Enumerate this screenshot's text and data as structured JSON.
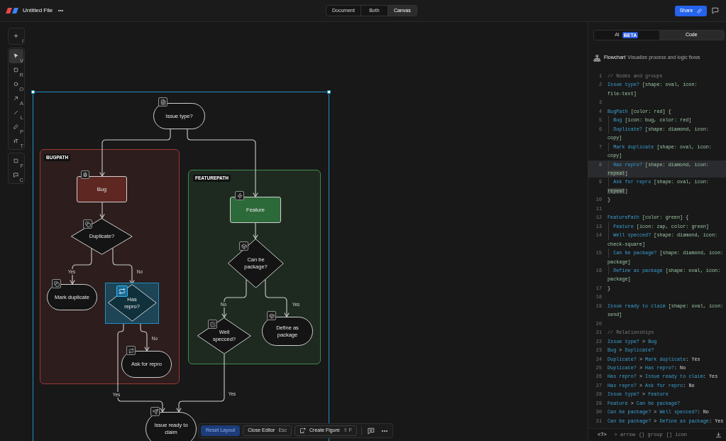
{
  "top_bar": {
    "title": "Untitled File",
    "view_modes": [
      {
        "label": "Document",
        "selected": false
      },
      {
        "label": "Both",
        "selected": false
      },
      {
        "label": "Canvas",
        "selected": true
      }
    ],
    "share_button": "Share"
  },
  "toolbar": {
    "groups": [
      {
        "tools": [
          {
            "shortcut": "I",
            "selected": false
          }
        ]
      },
      {
        "tools": [
          {
            "shortcut": "V",
            "selected": true
          },
          {
            "shortcut": "R",
            "selected": false
          },
          {
            "shortcut": "O",
            "selected": false
          },
          {
            "shortcut": "A",
            "selected": false
          },
          {
            "shortcut": "L",
            "selected": false
          },
          {
            "shortcut": "P",
            "selected": false
          },
          {
            "shortcut": "T",
            "selected": false
          }
        ]
      },
      {
        "tools": [
          {
            "shortcut": "F",
            "selected": false
          },
          {
            "shortcut": "C",
            "selected": false
          }
        ]
      }
    ]
  },
  "canvas": {
    "groups": [
      {
        "label": "BUGPATH",
        "color": "#9b3a35"
      },
      {
        "label": "FEATUREPATH",
        "color": "#3f8a4d"
      }
    ],
    "nodes": [
      {
        "label": "Issue type?",
        "kind": "oval",
        "selected": false
      },
      {
        "label": "Bug",
        "kind": "rect",
        "color": "#5e2722",
        "selected": false
      },
      {
        "label": "Duplicate?",
        "kind": "diamond",
        "selected": false
      },
      {
        "label": "Mark duplicate",
        "kind": "oval",
        "selected": false
      },
      {
        "label": "Has repro?",
        "kind": "diamond",
        "selected": true
      },
      {
        "label": "Ask for repro",
        "kind": "oval",
        "selected": false
      },
      {
        "label": "Feature",
        "kind": "rect",
        "color": "#2d6a3a",
        "selected": false
      },
      {
        "label": "Can be package?",
        "kind": "diamond",
        "selected": false
      },
      {
        "label": "Well specced?",
        "kind": "diamond",
        "selected": false
      },
      {
        "label": "Define as package",
        "kind": "oval",
        "selected": false
      },
      {
        "label": "Issue ready to claim",
        "kind": "oval",
        "selected": false
      }
    ],
    "edge_labels": [
      "Yes",
      "No",
      "No",
      "Yes",
      "No",
      "Yes",
      "Yes"
    ]
  },
  "canvas_toolbar": {
    "buttons": [
      {
        "label": "Reset Layout",
        "kind": "primary"
      },
      {
        "label": "Close Editor",
        "shortcut": "Esc",
        "kind": "secondary"
      },
      {
        "label": "Create Figure",
        "shortcut": "⇧ F",
        "kind": "secondary"
      }
    ]
  },
  "side_panel": {
    "tabs": [
      {
        "label": "AI",
        "badge": "BETA",
        "selected": false
      },
      {
        "label": "Code",
        "selected": true
      }
    ],
    "header": {
      "title": "Flowchart",
      "subtitle": "Visualize process and logic flows"
    },
    "code": {
      "lines": [
        {
          "number": "1",
          "current": false,
          "tokens": [
            {
              "kind": "comment",
              "text": "// Nodes and groups"
            }
          ]
        },
        {
          "number": "2",
          "current": false,
          "tokens": [
            {
              "kind": "name",
              "text": "Issue type?"
            },
            {
              "kind": "attr",
              "text": " [shape: oval, icon: file-text]"
            }
          ]
        },
        {
          "number": "3",
          "current": false
        },
        {
          "number": "4",
          "current": false,
          "tokens": [
            {
              "kind": "name",
              "text": "BugPath"
            },
            {
              "kind": "attr",
              "text": " [color: red]"
            },
            {
              "kind": "punct",
              "text": " {"
            }
          ],
          "children": [
            {
              "number": "5",
              "current": false,
              "tokens": [
                {
                  "kind": "name",
                  "text": "Bug"
                },
                {
                  "kind": "attr",
                  "text": " [icon: bug, color: red]"
                }
              ]
            },
            {
              "number": "6",
              "current": false,
              "tokens": [
                {
                  "kind": "name",
                  "text": "Duplicate?"
                },
                {
                  "kind": "attr",
                  "text": " [shape: diamond, icon: copy]"
                }
              ]
            },
            {
              "number": "7",
              "current": false,
              "tokens": [
                {
                  "kind": "name",
                  "text": "Mark duplicate"
                },
                {
                  "kind": "attr",
                  "text": " [shape: oval, icon: copy]"
                }
              ]
            },
            {
              "number": "8",
              "current": true,
              "tokens": [
                {
                  "kind": "name",
                  "text": "Has repro?"
                },
                {
                  "kind": "attr",
                  "text": " [shape: diamond, icon: "
                },
                {
                  "kind": "match",
                  "text": "repeat"
                },
                {
                  "kind": "attr",
                  "text": "]"
                }
              ]
            },
            {
              "number": "9",
              "current": false,
              "tokens": [
                {
                  "kind": "name",
                  "text": "Ask for repro"
                },
                {
                  "kind": "attr",
                  "text": " [shape: oval, icon: "
                },
                {
                  "kind": "match",
                  "text": "repeat"
                },
                {
                  "kind": "attr",
                  "text": "]"
                }
              ]
            }
          ]
        },
        {
          "number": "10",
          "current": false,
          "tokens": [
            {
              "kind": "punct",
              "text": "}"
            }
          ]
        },
        {
          "number": "11",
          "current": false
        },
        {
          "number": "12",
          "current": false,
          "tokens": [
            {
              "kind": "name",
              "text": "FeaturePath"
            },
            {
              "kind": "attr",
              "text": " [color: green]"
            },
            {
              "kind": "punct",
              "text": " {"
            }
          ],
          "children": [
            {
              "number": "13",
              "current": false,
              "tokens": [
                {
                  "kind": "name",
                  "text": "Feature"
                },
                {
                  "kind": "attr",
                  "text": " [icon: zap, color: green]"
                }
              ]
            },
            {
              "number": "14",
              "current": false,
              "tokens": [
                {
                  "kind": "name",
                  "text": "Well specced?"
                },
                {
                  "kind": "attr",
                  "text": " [shape: diamond, icon: check-square]"
                }
              ]
            },
            {
              "number": "15",
              "current": false,
              "tokens": [
                {
                  "kind": "name",
                  "text": "Can be package?"
                },
                {
                  "kind": "attr",
                  "text": " [shape: diamond, icon: package]"
                }
              ]
            },
            {
              "number": "16",
              "current": false,
              "tokens": [
                {
                  "kind": "name",
                  "text": "Define as package"
                },
                {
                  "kind": "attr",
                  "text": " [shape: oval, icon: package]"
                }
              ]
            }
          ]
        },
        {
          "number": "17",
          "current": false,
          "tokens": [
            {
              "kind": "punct",
              "text": "}"
            }
          ]
        },
        {
          "number": "18",
          "current": false
        },
        {
          "number": "19",
          "current": false,
          "tokens": [
            {
              "kind": "name",
              "text": "Issue ready to claim"
            },
            {
              "kind": "attr",
              "text": " [shape: oval, icon: send]"
            }
          ]
        },
        {
          "number": "20",
          "current": false
        },
        {
          "number": "21",
          "current": false,
          "tokens": [
            {
              "kind": "comment",
              "text": "// Relationships"
            }
          ]
        },
        {
          "number": "22",
          "current": false,
          "tokens": [
            {
              "kind": "name",
              "text": "Issue type?"
            },
            {
              "kind": "punct",
              "text": " > "
            },
            {
              "kind": "name",
              "text": "Bug"
            }
          ]
        },
        {
          "number": "23",
          "current": false,
          "tokens": [
            {
              "kind": "name",
              "text": "Bug"
            },
            {
              "kind": "punct",
              "text": " > "
            },
            {
              "kind": "name",
              "text": "Duplicate?"
            }
          ]
        },
        {
          "number": "24",
          "current": false,
          "tokens": [
            {
              "kind": "name",
              "text": "Duplicate?"
            },
            {
              "kind": "punct",
              "text": " > "
            },
            {
              "kind": "name",
              "text": "Mark duplicate"
            },
            {
              "kind": "label",
              "text": ": Yes"
            }
          ]
        },
        {
          "number": "25",
          "current": false,
          "tokens": [
            {
              "kind": "name",
              "text": "Duplicate?"
            },
            {
              "kind": "punct",
              "text": " > "
            },
            {
              "kind": "name",
              "text": "Has repro?"
            },
            {
              "kind": "label",
              "text": ": No"
            }
          ]
        },
        {
          "number": "26",
          "current": false,
          "tokens": [
            {
              "kind": "name",
              "text": "Has repro?"
            },
            {
              "kind": "punct",
              "text": " > "
            },
            {
              "kind": "name",
              "text": "Issue ready to claim"
            },
            {
              "kind": "label",
              "text": ": Yes"
            }
          ]
        },
        {
          "number": "27",
          "current": false,
          "tokens": [
            {
              "kind": "name",
              "text": "Has repro?"
            },
            {
              "kind": "punct",
              "text": " > "
            },
            {
              "kind": "name",
              "text": "Ask for repro"
            },
            {
              "kind": "label",
              "text": ": No"
            }
          ]
        },
        {
          "number": "28",
          "current": false,
          "tokens": [
            {
              "kind": "name",
              "text": "Issue type?"
            },
            {
              "kind": "punct",
              "text": " > "
            },
            {
              "kind": "name",
              "text": "Feature"
            }
          ]
        },
        {
          "number": "29",
          "current": false,
          "tokens": [
            {
              "kind": "name",
              "text": "Feature"
            },
            {
              "kind": "punct",
              "text": " > "
            },
            {
              "kind": "name",
              "text": "Can be package?"
            }
          ]
        },
        {
          "number": "30",
          "current": false,
          "tokens": [
            {
              "kind": "name",
              "text": "Can be package?"
            },
            {
              "kind": "punct",
              "text": " > "
            },
            {
              "kind": "name",
              "text": "Well specced?"
            },
            {
              "kind": "label",
              "text": ": No"
            }
          ]
        },
        {
          "number": "31",
          "current": false,
          "tokens": [
            {
              "kind": "name",
              "text": "Can be package?"
            },
            {
              "kind": "punct",
              "text": " > "
            },
            {
              "kind": "name",
              "text": "Define as package"
            },
            {
              "kind": "label",
              "text": ": Yes"
            }
          ]
        }
      ]
    },
    "footer": {
      "help_symbol": "<?>",
      "hints": [
        "> arrow",
        "{} group",
        "[] icon"
      ]
    }
  }
}
